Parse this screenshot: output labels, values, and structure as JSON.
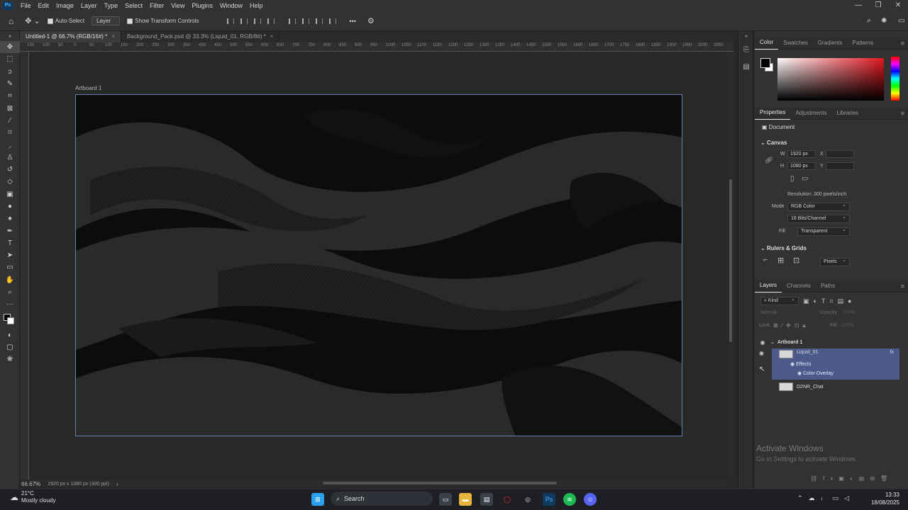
{
  "app": {
    "logo": "Ps",
    "window_controls": [
      "—",
      "❐",
      "✕"
    ]
  },
  "menu": [
    "File",
    "Edit",
    "Image",
    "Layer",
    "Type",
    "Select",
    "Filter",
    "View",
    "Plugins",
    "Window",
    "Help"
  ],
  "options": {
    "auto_select": "Auto-Select",
    "layer_select": "Layer",
    "show_transform": "Show Transform Controls",
    "more": "•••"
  },
  "tabs": [
    {
      "label": "Untitled-1 @ 66.7% (RGB/16#) *",
      "close": "×"
    },
    {
      "label": "Background_Pack.psd @ 33.3% (Liquid_01, RGB/8#) *",
      "close": "×"
    }
  ],
  "ruler_ticks": [
    "150",
    "100",
    "50",
    "0",
    "50",
    "100",
    "150",
    "200",
    "250",
    "300",
    "350",
    "400",
    "450",
    "500",
    "550",
    "600",
    "650",
    "700",
    "750",
    "800",
    "850",
    "900",
    "950",
    "1000",
    "1050",
    "1100",
    "1150",
    "1200",
    "1250",
    "1300",
    "1350",
    "1400",
    "1450",
    "1500",
    "1550",
    "1600",
    "1650",
    "1700",
    "1750",
    "1800",
    "1850",
    "1900",
    "1950",
    "2000",
    "2050"
  ],
  "artboard": {
    "label": "Artboard 1"
  },
  "status": {
    "zoom": "66.67%",
    "dims": "1920 px x 1080 px (300 ppi)",
    "arrow": "›"
  },
  "color_panel": {
    "tabs": [
      "Color",
      "Swatches",
      "Gradients",
      "Patterns"
    ]
  },
  "properties": {
    "tabs": [
      "Properties",
      "Adjustments",
      "Libraries"
    ],
    "doc_label": "Document",
    "canvas_title": "Canvas",
    "w_label": "W",
    "w_value": "1920 px",
    "h_label": "H",
    "h_value": "1080 px",
    "x_label": "X",
    "y_label": "Y",
    "resolution": "Resolution: 300 pixels/inch",
    "mode_label": "Mode",
    "mode_value": "RGB Color",
    "bits_value": "16 Bits/Channel",
    "fill_label": "Fill",
    "fill_value": "Transparent",
    "rulers_title": "Rulers & Grids",
    "units_value": "Pixels"
  },
  "layers": {
    "tabs": [
      "Layers",
      "Channels",
      "Paths"
    ],
    "kind": "Kind",
    "blend": "Normal",
    "opacity_label": "Opacity:",
    "opacity_value": "100%",
    "lock_label": "Lock:",
    "fill_label": "Fill:",
    "fill_value": "100%",
    "artboard": "Artboard 1",
    "layer1": "Liquid_01",
    "fx": "fx",
    "effects": "Effects",
    "color_overlay": "Color Overlay",
    "layer2": "D2NR_Chat"
  },
  "activate": {
    "title": "Activate Windows",
    "sub": "Go to Settings to activate Windows."
  },
  "taskbar": {
    "weather_temp": "21°C",
    "weather_desc": "Mostly cloudy",
    "search": "Search",
    "time": "13:33",
    "date": "18/08/2025"
  }
}
